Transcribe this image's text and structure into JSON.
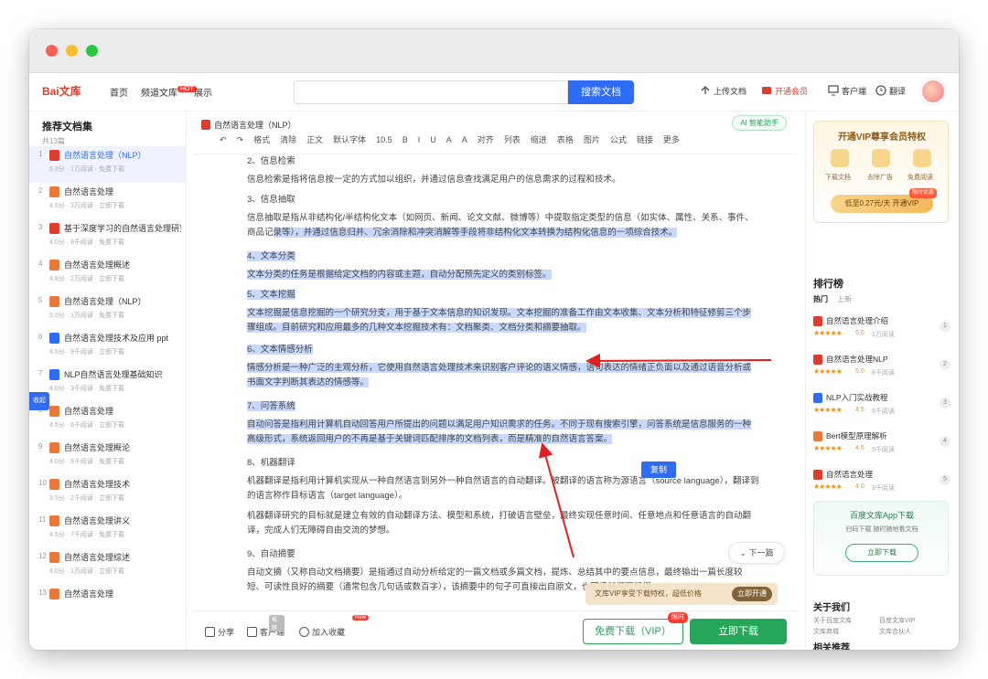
{
  "header": {
    "logo": "Bai文库",
    "nav": [
      {
        "label": "首页"
      },
      {
        "label": "频道文库",
        "badge": "HOT"
      },
      {
        "label": "展示"
      }
    ],
    "search_placeholder": "",
    "search_button": "搜索文档",
    "tools": [
      "上传文档",
      "开通会员",
      "客户端",
      "翻译"
    ]
  },
  "left_panel": {
    "title": "推荐文档集",
    "subtitle": "共13篇",
    "side_tab": "收起",
    "items": [
      {
        "index": "1",
        "name": "自然语言处理（NLP）",
        "meta": "5.0分 · 1万阅读 · 免费下载",
        "color": "#e03c2d",
        "active": true
      },
      {
        "index": "2",
        "name": "自然语言处理",
        "meta": "4.5分 · 3万阅读 · 立即下载",
        "color": "#e8793a",
        "active": false
      },
      {
        "index": "3",
        "name": "基于深度学习的自然语言处理研究",
        "meta": "4.0分 · 8千阅读 · 免费下载",
        "color": "#e03c2d",
        "active": false
      },
      {
        "index": "4",
        "name": "自然语言处理概述",
        "meta": "4.8分 · 2万阅读 · 立即下载",
        "color": "#e8793a",
        "active": false
      },
      {
        "index": "5",
        "name": "自然语言处理（NLP）",
        "meta": "5.0分 · 1万阅读 · 免费下载",
        "color": "#e8793a",
        "active": false
      },
      {
        "index": "6",
        "name": "自然语言处理技术及应用 ppt",
        "meta": "4.5分 · 9千阅读 · 立即下载",
        "color": "#2f6cf6",
        "active": false
      },
      {
        "index": "7",
        "name": "NLP自然语言处理基础知识",
        "meta": "4.0分 · 3千阅读 · 免费下载",
        "color": "#2f6cf6",
        "active": false
      },
      {
        "index": "8",
        "name": "自然语言处理",
        "meta": "4.5分 · 6千阅读 · 立即下载",
        "color": "#e8793a",
        "active": false
      },
      {
        "index": "9",
        "name": "自然语言处理概论",
        "meta": "4.0分 · 5千阅读 · 免费下载",
        "color": "#e8793a",
        "active": false
      },
      {
        "index": "10",
        "name": "自然语言处理技术",
        "meta": "3.5分 · 2千阅读 · 立即下载",
        "color": "#e8793a",
        "active": false
      },
      {
        "index": "11",
        "name": "自然语言处理讲义",
        "meta": "4.5分 · 7千阅读 · 免费下载",
        "color": "#e8793a",
        "active": false
      },
      {
        "index": "12",
        "name": "自然语言处理综述",
        "meta": "4.0分 · 1万阅读 · 立即下载",
        "color": "#e8793a",
        "active": false
      },
      {
        "index": "13",
        "name": "自然语言处理",
        "meta": "",
        "color": "#e8793a",
        "active": false
      }
    ]
  },
  "editor": {
    "doc_title": "自然语言处理（NLP）",
    "ai_chip": "AI 智能助手",
    "toolbar": [
      "↶",
      "↷",
      "格式",
      "清除",
      "正文",
      "默认字体",
      "10.5",
      "B",
      "I",
      "U",
      "A",
      "A",
      "对齐",
      "列表",
      "缩进",
      "表格",
      "图片",
      "公式",
      "链接",
      "更多"
    ],
    "paragraphs": [
      {
        "text": "2、信息检索",
        "heading": true,
        "selected": false
      },
      {
        "text": "信息检索是指将信息按一定的方式加以组织，并通过信息查找满足用户的信息需求的过程和技术。",
        "heading": false,
        "selected": false
      },
      {
        "text": "3、信息抽取",
        "heading": true,
        "selected": false
      },
      {
        "text": "信息抽取是指从非结构化/半结构化文本（如网页、新闻、论文文献、微博等）中提取指定类型的信息（如实体、属性、关系、事件、商品记录等），并通过信息归并、冗余消除和冲突消解等手段将非结构化文本转换为结构化信息的一项综合技术。",
        "heading": false,
        "selected": "partial"
      },
      {
        "text": "4、文本分类",
        "heading": true,
        "selected": true
      },
      {
        "text": "文本分类的任务是根据给定文档的内容或主题，自动分配预先定义的类别标签。",
        "heading": false,
        "selected": true
      },
      {
        "text": "5、文本挖掘",
        "heading": true,
        "selected": true
      },
      {
        "text": "文本挖掘是信息挖掘的一个研究分支，用于基于文本信息的知识发现。文本挖掘的准备工作由文本收集、文本分析和特征修剪三个步骤组成。目前研究和应用最多的几种文本挖掘技术有：文档聚类、文档分类和摘要抽取。",
        "heading": false,
        "selected": true
      },
      {
        "text": "6、文本情感分析",
        "heading": true,
        "selected": true
      },
      {
        "text": "情感分析是一种广泛的主观分析，它使用自然语言处理技术来识别客户评论的语义情感，语句表达的情绪正负面以及通过语音分析或书面文字判断其表达的情感等。",
        "heading": false,
        "selected": true
      },
      {
        "text": "7、问答系统",
        "heading": true,
        "selected": true
      },
      {
        "text": "自动问答是指利用计算机自动回答用户所提出的问题以满足用户知识需求的任务。不同于现有搜索引擎，问答系统是信息服务的一种高级形式，系统返回用户的不再是基于关键词匹配排序的文档列表，而是精准的自然语言答案。",
        "heading": false,
        "selected": true
      },
      {
        "text": "8、机器翻译",
        "heading": true,
        "selected": false
      },
      {
        "text": "机器翻译是指利用计算机实现从一种自然语言到另外一种自然语言的自动翻译。被翻译的语言称为源语言（source language），翻译到的语言称作目标语言（target language）。",
        "heading": false,
        "selected": false
      },
      {
        "text": "机器翻译研究的目标就是建立有效的自动翻译方法、模型和系统，打破语言壁垒，最终实现任意时间、任意地点和任意语言的自动翻译，完成人们无障碍自由交流的梦想。",
        "heading": false,
        "selected": false
      },
      {
        "text": "9、自动摘要",
        "heading": true,
        "selected": false
      },
      {
        "text": "自动文摘（又称自动文档摘要）是指通过自动分析给定的一篇文档或多篇文档，提炼、总结其中的要点信息，最终输出一篇长度较短、可读性良好的摘要（通常包含几句话或数百字），该摘要中的句子可直接出自原文，也可重新撰写所得。",
        "heading": false,
        "selected": false
      }
    ],
    "copy_button": "复制",
    "next_button": "下一篇",
    "toast_text": "文库VIP享受下载特权，超低价格",
    "toast_button": "立即开通",
    "bottom": {
      "actions": [
        {
          "label": "分享",
          "badge": ""
        },
        {
          "label": "客户端",
          "badge": "推荐"
        },
        {
          "label": "加入收藏",
          "badge": "New"
        }
      ],
      "download_ghost": "免费下载（VIP）",
      "download_ghost_tag": "限时",
      "download_primary": "立即下载"
    }
  },
  "right_panel": {
    "vip_title": "开通VIP尊享会员特权",
    "vip_benefits": [
      "下载文档",
      "去除广告",
      "免费阅读"
    ],
    "vip_button": "低至0.27元/天 开通VIP",
    "vip_button_tag": "限时优惠",
    "ranking_title": "排行榜",
    "ranking_tabs": [
      "热门",
      "上新"
    ],
    "ranking": [
      {
        "name": "自然语言处理介绍",
        "score": "5.0",
        "sub": "1万阅读",
        "color": "#e03c2d",
        "dot": "1"
      },
      {
        "name": "自然语言处理NLP",
        "score": "5.0",
        "sub": "8千阅读",
        "color": "#e03c2d",
        "dot": "2"
      },
      {
        "name": "NLP入门实战教程",
        "score": "4.5",
        "sub": "6千阅读",
        "color": "#2f6cf6",
        "dot": "3"
      },
      {
        "name": "Bert模型原理解析",
        "score": "4.5",
        "sub": "5千阅读",
        "color": "#e8793a",
        "dot": "4"
      },
      {
        "name": "自然语言处理",
        "score": "4.0",
        "sub": "3千阅读",
        "color": "#e03c2d",
        "dot": "5"
      }
    ],
    "app_title": "百度文库App下载",
    "app_sub": "扫码下载 随时随地看文档",
    "app_button": "立即下载",
    "about_title": "关于我们",
    "about_links": [
      "关于百度文库",
      "百度文库VIP",
      "文库商城",
      "文库合伙人"
    ],
    "fav_title": "相关推荐"
  },
  "annotations": {
    "arrow_color": "#e02020"
  }
}
